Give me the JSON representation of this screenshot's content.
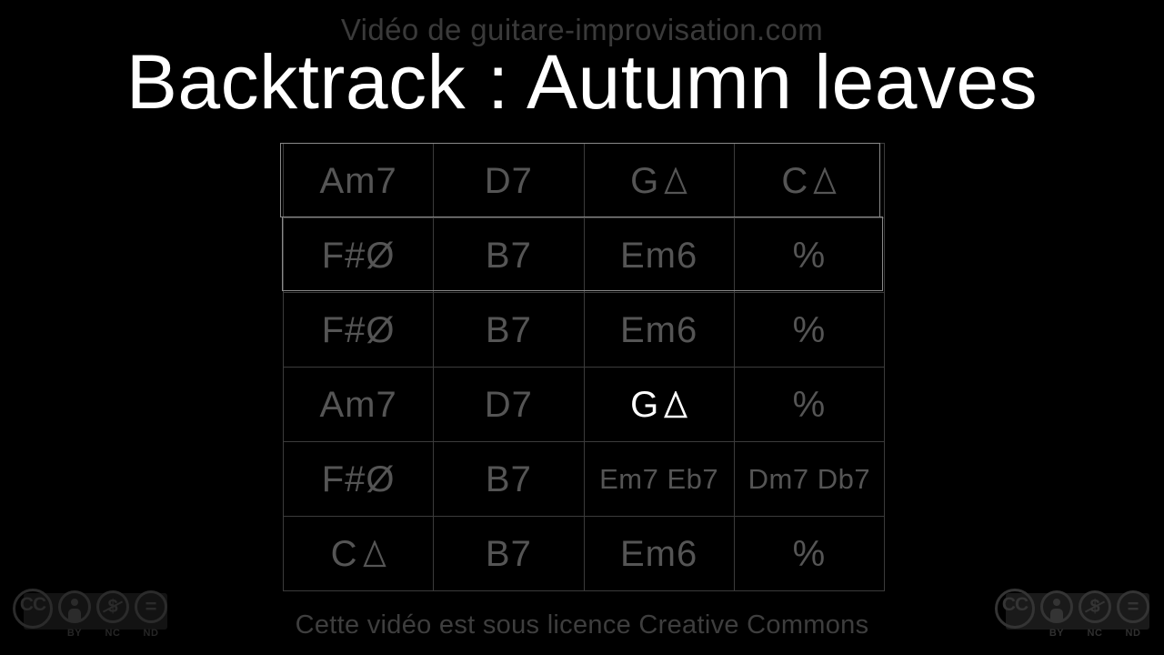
{
  "header": {
    "channel_line": "Vidéo de guitare-improvisation.com",
    "title": "Backtrack : Autumn leaves"
  },
  "footer": {
    "license_text": "Cette vidéo est sous licence Creative Commons"
  },
  "colors": {
    "background": "#000000",
    "title_text": "#ffffff",
    "chord_text": "#555555",
    "active_chord_text": "#ffffff",
    "grid_line": "#3c3c3c",
    "grid_outer": "#4a4a4a",
    "highlight_border": "#8a8a8a",
    "muted_text": "#3a3a3a"
  },
  "chord_chart": {
    "columns": 4,
    "rows": 6,
    "repeat_symbol": "%",
    "cells": [
      [
        {
          "text": "Am7",
          "active": false,
          "dual": false,
          "triangle": false
        },
        {
          "text": "D7",
          "active": false,
          "dual": false,
          "triangle": false
        },
        {
          "text": "G",
          "active": false,
          "dual": false,
          "triangle": true
        },
        {
          "text": "C",
          "active": false,
          "dual": false,
          "triangle": true
        }
      ],
      [
        {
          "text": "F#Ø",
          "active": false,
          "dual": false,
          "triangle": false
        },
        {
          "text": "B7",
          "active": false,
          "dual": false,
          "triangle": false
        },
        {
          "text": "Em6",
          "active": false,
          "dual": false,
          "triangle": false
        },
        {
          "text": "%",
          "active": false,
          "dual": false,
          "triangle": false
        }
      ],
      [
        {
          "text": "F#Ø",
          "active": false,
          "dual": false,
          "triangle": false
        },
        {
          "text": "B7",
          "active": false,
          "dual": false,
          "triangle": false
        },
        {
          "text": "Em6",
          "active": false,
          "dual": false,
          "triangle": false
        },
        {
          "text": "%",
          "active": false,
          "dual": false,
          "triangle": false
        }
      ],
      [
        {
          "text": "Am7",
          "active": false,
          "dual": false,
          "triangle": false
        },
        {
          "text": "D7",
          "active": false,
          "dual": false,
          "triangle": false
        },
        {
          "text": "G",
          "active": true,
          "dual": false,
          "triangle": true
        },
        {
          "text": "%",
          "active": false,
          "dual": false,
          "triangle": false
        }
      ],
      [
        {
          "text": "F#Ø",
          "active": false,
          "dual": false,
          "triangle": false
        },
        {
          "text": "B7",
          "active": false,
          "dual": false,
          "triangle": false
        },
        {
          "text": "Em7 Eb7",
          "active": false,
          "dual": true,
          "triangle": false
        },
        {
          "text": "Dm7 Db7",
          "active": false,
          "dual": true,
          "triangle": false
        }
      ],
      [
        {
          "text": "C",
          "active": false,
          "dual": false,
          "triangle": true
        },
        {
          "text": "B7",
          "active": false,
          "dual": false,
          "triangle": false
        },
        {
          "text": "Em6",
          "active": false,
          "dual": false,
          "triangle": false
        },
        {
          "text": "%",
          "active": false,
          "dual": false,
          "triangle": false
        }
      ]
    ],
    "highlighted_rows": [
      0,
      1
    ]
  },
  "cc_badges": {
    "left": {
      "mark": "CC",
      "icons": [
        "by-person-icon",
        "nc-no-money-icon",
        "nd-no-derivatives-icon"
      ],
      "labels": [
        "BY",
        "NC",
        "ND"
      ],
      "dollar_glyph": "$",
      "equals_glyph": "="
    },
    "right": {
      "mark": "CC",
      "icons": [
        "by-person-icon",
        "nc-no-money-icon",
        "nd-no-derivatives-icon"
      ],
      "labels": [
        "BY",
        "NC",
        "ND"
      ],
      "dollar_glyph": "$",
      "equals_glyph": "="
    }
  }
}
